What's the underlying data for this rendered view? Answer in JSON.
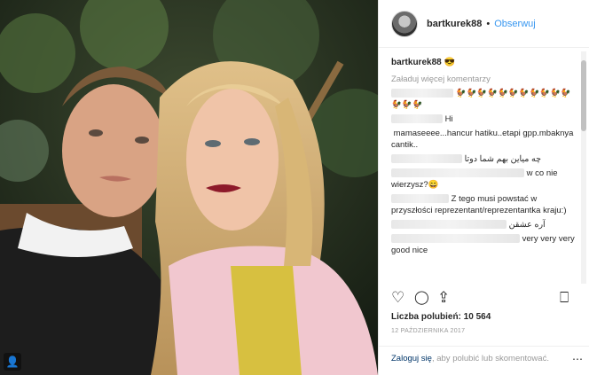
{
  "post": {
    "username": "bartkurek88",
    "follow_label": "Obserwuj",
    "separator": "•",
    "owner_name": "bartkurek88",
    "owner_emoji": "😎",
    "load_more": "Załaduj więcej komentarzy",
    "comments": [
      {
        "user": "",
        "text": "🐓🐓🐓🐓🐓🐓🐓🐓🐓🐓🐓🐓🐓🐓"
      },
      {
        "user": "",
        "text": "Hi"
      },
      {
        "user": "",
        "text": "mamaseeee...hancur hatiku..etapi gpp.mbaknya cantik.."
      },
      {
        "user": "",
        "text": "چه میاین بهم شما دوتا"
      },
      {
        "user": "",
        "text": "w co nie wierzysz?😄"
      },
      {
        "user": "",
        "text": "Z tego musi powstać w przyszłości reprezentant/reprezentantka kraju:)"
      },
      {
        "user": "",
        "text": "آره عشقن"
      },
      {
        "user": "",
        "text": "very very very good nice"
      }
    ],
    "likes_label": "Liczba polubień: 10 564",
    "date": "12 PAŹDZIERNIKA 2017",
    "login_link": "Zaloguj się",
    "login_rest": ", aby polubić lub skomentować.",
    "more_icon": "⋯"
  },
  "icons": {
    "heart": "♡",
    "comment": "◯",
    "share": "⇪",
    "bookmark": "⎕",
    "user_tag": "👤"
  }
}
